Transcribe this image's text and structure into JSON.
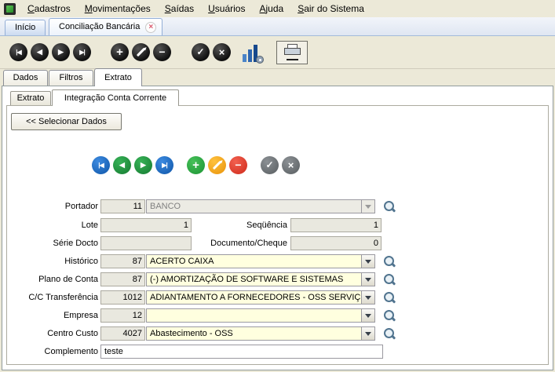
{
  "colors": {
    "chrome": "#ECE9D8",
    "field_yellow": "#FFFFDF",
    "disabled_field": "#ECEBE4",
    "nav_blue": "#1467C6",
    "nav_green": "#1D9E3C",
    "add_green": "#2DB24A",
    "edit_orange": "#F2A10E",
    "remove_red": "#E23B2E",
    "neutral_gray": "#6F7477"
  },
  "menubar": {
    "items": [
      "Cadastros",
      "Movimentações",
      "Saídas",
      "Usuários",
      "Ajuda",
      "Sair do Sistema"
    ]
  },
  "window_tabs": {
    "home": "Início",
    "active": "Conciliação Bancária"
  },
  "icons": {
    "first": "|◀",
    "prev": "◀",
    "next": "▶",
    "last": "▶|",
    "add": "+",
    "remove": "−",
    "ok": "✓",
    "cancel": "×",
    "close": "×"
  },
  "page_tabs": {
    "dados": "Dados",
    "filtros": "Filtros",
    "extrato": "Extrato"
  },
  "sub_tabs": {
    "extrato": "Extrato",
    "integracao": "Integração Conta Corrente"
  },
  "buttons": {
    "selecionar": "<< Selecionar Dados"
  },
  "form": {
    "portador": {
      "label": "Portador",
      "code": "11",
      "value": "BANCO"
    },
    "lote": {
      "label": "Lote",
      "value": "1"
    },
    "sequencia": {
      "label": "Seqüência",
      "value": "1"
    },
    "serie_docto": {
      "label": "Série Docto",
      "value": ""
    },
    "documento_cheque": {
      "label": "Documento/Cheque",
      "value": "0"
    },
    "historico": {
      "label": "Histórico",
      "code": "87",
      "value": "ACERTO CAIXA"
    },
    "plano_de_conta": {
      "label": "Plano de Conta",
      "code": "87",
      "value": "(-) AMORTIZAÇÃO DE SOFTWARE E SISTEMAS"
    },
    "cc_transferencia": {
      "label": "C/C Transferência",
      "code": "1012",
      "value": "ADIANTAMENTO A FORNECEDORES - OSS SERVIÇ"
    },
    "empresa": {
      "label": "Empresa",
      "code": "12",
      "value": ""
    },
    "centro_custo": {
      "label": "Centro Custo",
      "code": "4027",
      "value": "Abastecimento - OSS"
    },
    "complemento": {
      "label": "Complemento",
      "value": "teste"
    }
  }
}
